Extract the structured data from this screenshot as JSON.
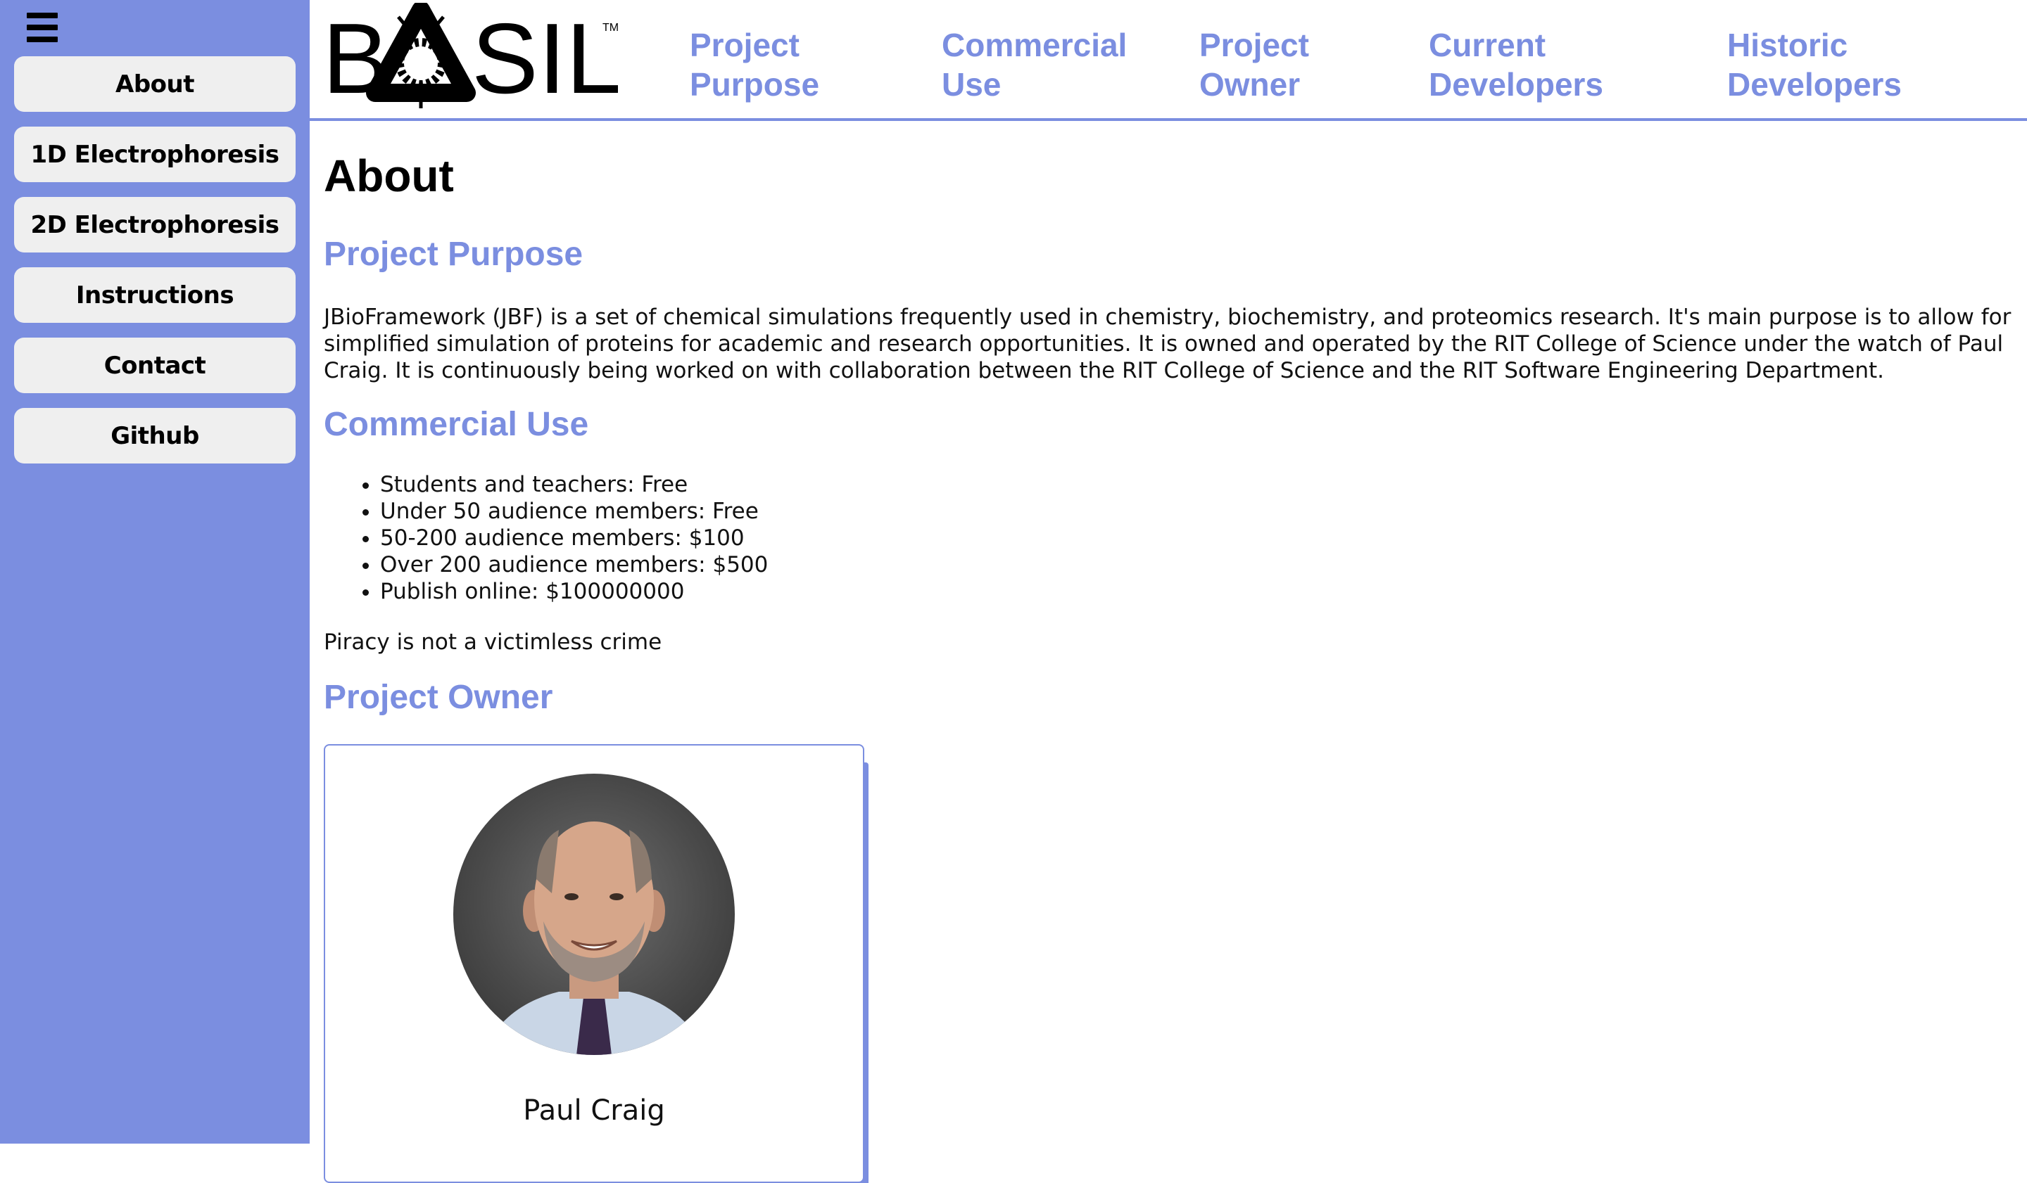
{
  "sidebar": {
    "menu_icon": "hamburger-menu-icon",
    "accent_color": "#7b8ee0",
    "items": [
      {
        "label": "About"
      },
      {
        "label": "1D Electrophoresis"
      },
      {
        "label": "2D Electrophoresis"
      },
      {
        "label": "Instructions"
      },
      {
        "label": "Contact"
      },
      {
        "label": "Github"
      }
    ]
  },
  "header": {
    "logo": {
      "text_prefix": "B",
      "text_suffix": "SIL",
      "trademark": "TM",
      "icon": "molecule-logo-icon"
    },
    "nav": [
      {
        "line1": "Project",
        "line2": "Purpose"
      },
      {
        "line1": "Commercial",
        "line2": "Use"
      },
      {
        "line1": "Project",
        "line2": "Owner"
      },
      {
        "line1": "Current",
        "line2": "Developers"
      },
      {
        "line1": "Historic",
        "line2": "Developers"
      }
    ]
  },
  "main": {
    "title": "About",
    "purpose": {
      "heading": "Project Purpose",
      "text": "JBioFramework (JBF) is a set of chemical simulations frequently used in chemistry, biochemistry, and proteomics research. It's main purpose is to allow for simplified simulation of proteins for academic and research opportunities. It is owned and operated by the RIT College of Science under the watch of Paul Craig. It is continuously being worked on with collaboration between the RIT College of Science and the RIT Software Engineering Department."
    },
    "commercial": {
      "heading": "Commercial Use",
      "items": [
        "Students and teachers: Free",
        "Under 50 audience members: Free",
        "50-200 audience members: $100",
        "Over 200 audience members: $500",
        "Publish online: $100000000"
      ],
      "note": "Piracy is not a victimless crime"
    },
    "owner": {
      "heading": "Project Owner",
      "name": "Paul Craig",
      "photo_icon": "person-photo"
    }
  }
}
